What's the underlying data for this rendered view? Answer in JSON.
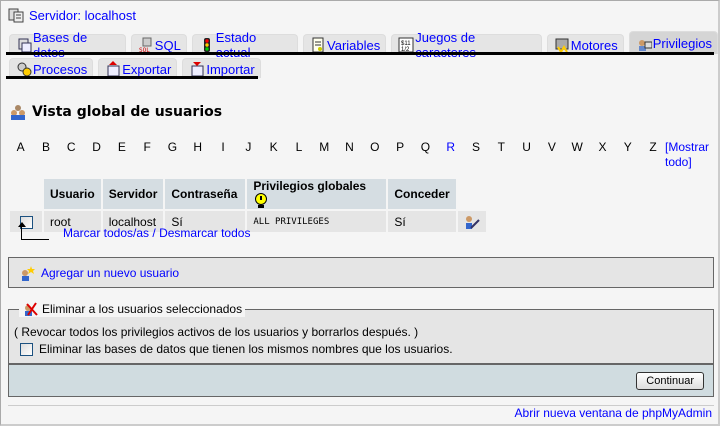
{
  "server": {
    "label": "Servidor: localhost",
    "icon": "server-icon"
  },
  "tabs_row1": [
    {
      "label": "Bases de datos",
      "icon": "databases-icon"
    },
    {
      "label": "SQL",
      "icon": "sql-icon"
    },
    {
      "label": "Estado actual",
      "icon": "traffic-light-icon"
    },
    {
      "label": "Variables",
      "icon": "variables-icon"
    },
    {
      "label": "Juegos de caracteres",
      "icon": "charset-icon"
    },
    {
      "label": "Motores",
      "icon": "engines-icon"
    },
    {
      "label": "Privilegios",
      "icon": "privileges-icon",
      "active": true
    }
  ],
  "tabs_row2": [
    {
      "label": "Procesos",
      "icon": "processes-icon"
    },
    {
      "label": "Exportar",
      "icon": "export-icon"
    },
    {
      "label": "Importar",
      "icon": "import-icon"
    }
  ],
  "page_title": "Vista global de usuarios",
  "letters": [
    "A",
    "B",
    "C",
    "D",
    "E",
    "F",
    "G",
    "H",
    "I",
    "J",
    "K",
    "L",
    "M",
    "N",
    "O",
    "P",
    "Q",
    "R",
    "S",
    "T",
    "U",
    "V",
    "W",
    "X",
    "Y",
    "Z"
  ],
  "active_letter": "R",
  "show_all": "[Mostrar todo]",
  "table": {
    "headers": [
      "Usuario",
      "Servidor",
      "Contraseña",
      "Privilegios globales",
      "Conceder"
    ],
    "rows": [
      {
        "user": "root",
        "host": "localhost",
        "password": "Sí",
        "privileges": "ALL PRIVILEGES",
        "grant": "Sí"
      }
    ]
  },
  "check_all": "Marcar todos/as",
  "separator": "/",
  "uncheck_all": "Desmarcar todos",
  "add_user": "Agregar un nuevo usuario",
  "delete": {
    "legend": "Eliminar a los usuarios seleccionados",
    "note": "( Revocar todos los privilegios activos de los usuarios y borrarlos después. )",
    "drop_db_label": "Eliminar las bases de datos que tienen los mismos nombres que los usuarios.",
    "button": "Continuar"
  },
  "new_window": "Abrir nueva ventana de phpMyAdmin",
  "colors": {
    "link": "#0000ff",
    "header_bg": "#d5dde2",
    "cell_bg": "#e5e5e5",
    "footer_bg": "#d0dce0"
  }
}
